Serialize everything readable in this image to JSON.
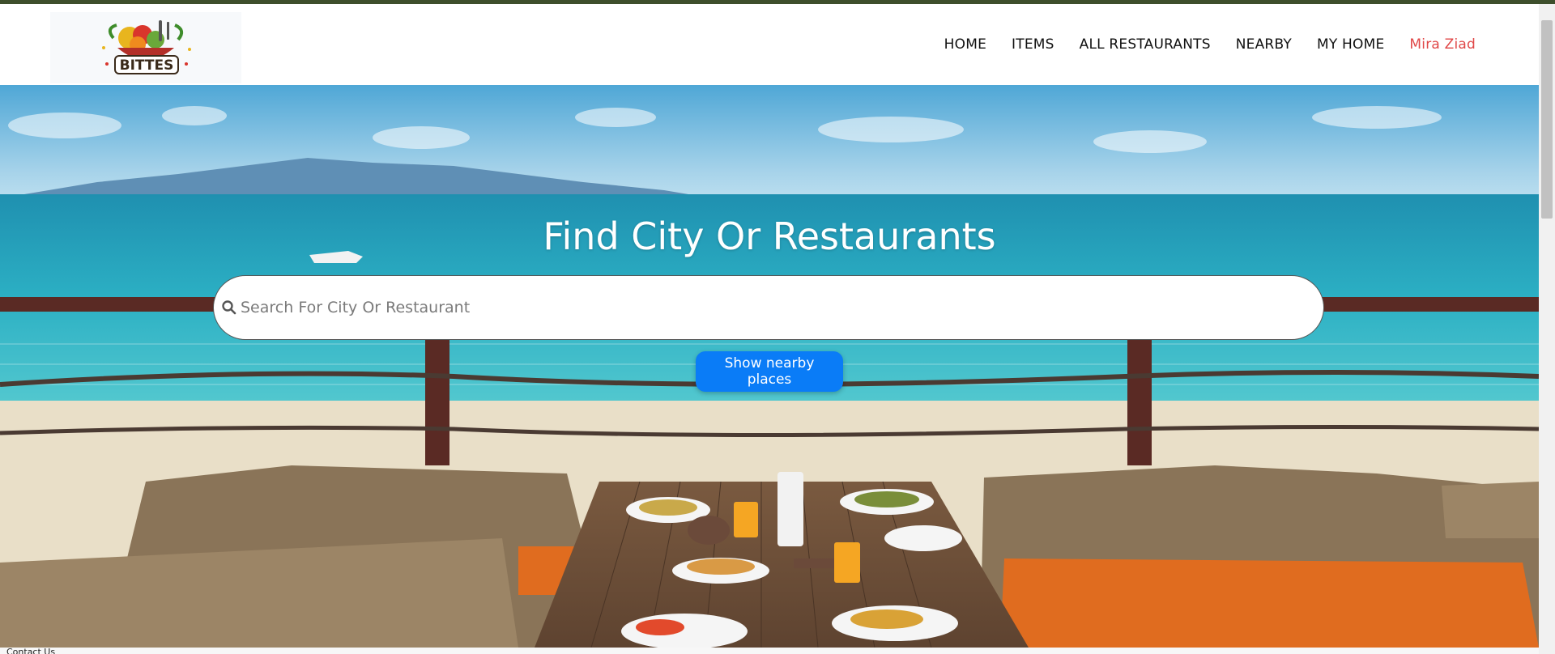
{
  "header": {
    "logo_text": "BITTES",
    "nav": [
      {
        "label": "HOME"
      },
      {
        "label": "ITEMS"
      },
      {
        "label": "ALL RESTAURANTS"
      },
      {
        "label": "NEARBY"
      },
      {
        "label": "MY HOME"
      },
      {
        "label": "Mira Ziad"
      }
    ]
  },
  "hero": {
    "title": "Find City Or Restaurants",
    "search_placeholder": "Search For City Or Restaurant",
    "nearby_button": "Show nearby places"
  },
  "footer": {
    "text": "Contact Us"
  },
  "colors": {
    "accent": "#0a7cf7",
    "user": "#e04848",
    "top_strip": "#3e4f2c"
  }
}
